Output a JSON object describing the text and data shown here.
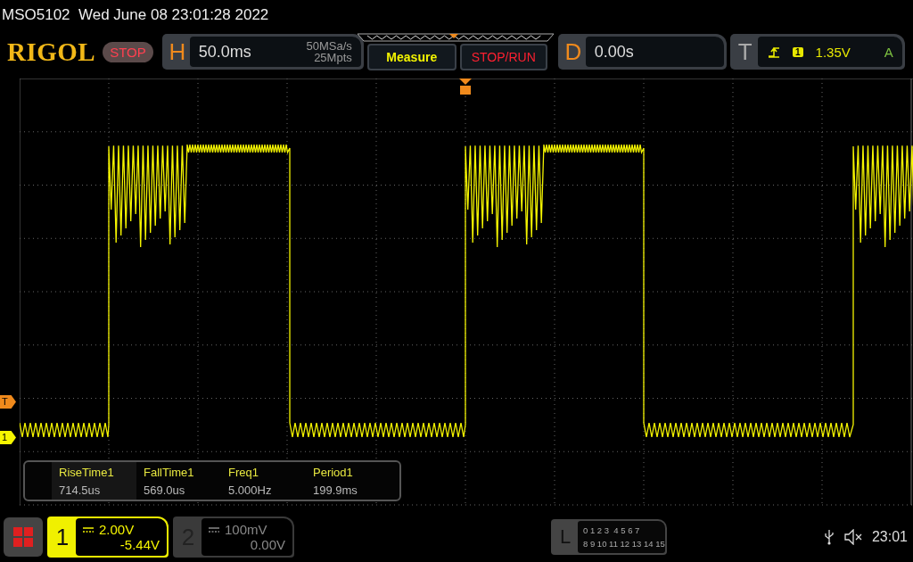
{
  "header": {
    "model": "MSO5102",
    "datetime": "Wed June 08 23:01:28 2022"
  },
  "logo": "RIGOL",
  "run_state": "STOP",
  "horizontal": {
    "label": "H",
    "timebase": "50.0ms",
    "sample_rate": "50MSa/s",
    "memory_depth": "25Mpts"
  },
  "buttons": [
    {
      "label": "Measure",
      "kind": "menu"
    },
    {
      "label": "STOP/RUN",
      "kind": "run"
    }
  ],
  "delay": {
    "label": "D",
    "value": "0.00s"
  },
  "trigger": {
    "label": "T",
    "source": "1",
    "level": "1.35V",
    "mode": "A"
  },
  "markers": [
    {
      "label": "T",
      "color": "#f08a1c"
    },
    {
      "label": "1",
      "color": "#f5f500"
    }
  ],
  "measurements": [
    {
      "name": "RiseTime1",
      "value": "714.5us",
      "selected": true
    },
    {
      "name": "FallTime1",
      "value": "569.0us",
      "selected": false
    },
    {
      "name": "Freq1",
      "value": "5.000Hz",
      "selected": false
    },
    {
      "name": "Period1",
      "value": "199.9ms",
      "selected": false
    }
  ],
  "channels": [
    {
      "number": "1",
      "scale": "2.00V",
      "offset": "-5.44V",
      "active": true
    },
    {
      "number": "2",
      "scale": "100mV",
      "offset": "0.00V",
      "active": false
    }
  ],
  "logic": {
    "label": "L",
    "rows": [
      "0 1 2 3  4 5 6 7",
      "8 9 10 11 12 13 14 15"
    ]
  },
  "clock": "23:01"
}
